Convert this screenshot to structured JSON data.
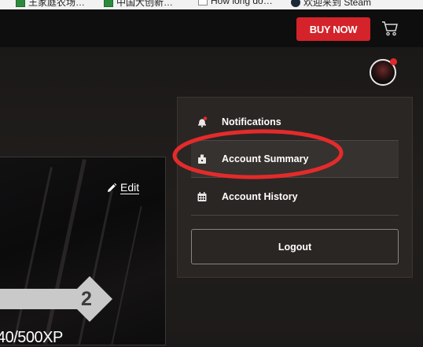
{
  "bookmarks": [
    {
      "label": "王家庭农场…",
      "icon": "green-doc-icon"
    },
    {
      "label": "中国大创新…",
      "icon": "green-doc-icon"
    },
    {
      "label": "How long do…",
      "icon": "page-icon"
    },
    {
      "label": "欢迎来到 Steam",
      "icon": "steam-icon"
    }
  ],
  "header": {
    "buy_label": "BUY NOW",
    "buy_color": "#d4232a",
    "cart_icon": "cart-icon"
  },
  "profile": {
    "edit_label": "Edit",
    "level": "2",
    "xp_text": "40/500XP"
  },
  "menu": {
    "items": [
      {
        "label": "Notifications",
        "icon": "bell-icon"
      },
      {
        "label": "Account Summary",
        "icon": "badge-icon"
      },
      {
        "label": "Account History",
        "icon": "calendar-icon"
      }
    ],
    "logout_label": "Logout"
  },
  "annotation_color": "#e32b2b"
}
